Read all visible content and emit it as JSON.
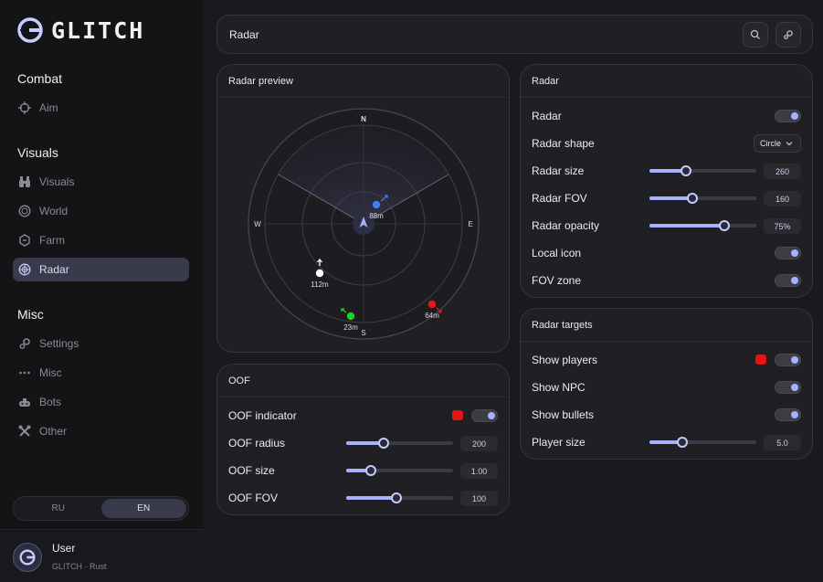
{
  "app": {
    "logo_text": "GLITCH"
  },
  "sidebar": {
    "sections": {
      "combat": "Combat",
      "visuals": "Visuals",
      "misc": "Misc"
    },
    "items": {
      "aim": "Aim",
      "visuals": "Visuals",
      "world": "World",
      "farm": "Farm",
      "radar": "Radar",
      "settings": "Settings",
      "misc": "Misc",
      "bots": "Bots",
      "other": "Other"
    },
    "active_item": "Radar",
    "language": {
      "options": [
        "RU",
        "EN"
      ],
      "selected": "EN"
    },
    "user": {
      "name": "User",
      "subtitle": "GLITCH · Rust"
    }
  },
  "header": {
    "title": "Radar"
  },
  "radar_preview": {
    "title": "Radar preview",
    "compass": {
      "north": "N",
      "east": "E",
      "south": "S",
      "west": "W"
    },
    "targets": [
      {
        "label": "88m",
        "color": "#3d7ef0"
      },
      {
        "label": "112m",
        "color": "#ffffff"
      },
      {
        "label": "23m",
        "color": "#1fd11f"
      },
      {
        "label": "64m",
        "color": "#e51616"
      }
    ]
  },
  "oof": {
    "title": "OOF",
    "indicator": {
      "label": "OOF indicator",
      "color": "#e21414",
      "enabled": true
    },
    "radius": {
      "label": "OOF radius",
      "value": "200",
      "fraction": 0.35
    },
    "size": {
      "label": "OOF size",
      "value": "1.00",
      "fraction": 0.23
    },
    "fov": {
      "label": "OOF FOV",
      "value": "100",
      "fraction": 0.47
    }
  },
  "radar_settings": {
    "title": "Radar",
    "radar": {
      "label": "Radar",
      "enabled": true
    },
    "shape": {
      "label": "Radar shape",
      "value": "Circle"
    },
    "size": {
      "label": "Radar size",
      "value": "260",
      "fraction": 0.34
    },
    "fov": {
      "label": "Radar FOV",
      "value": "160",
      "fraction": 0.4
    },
    "opacity": {
      "label": "Radar opacity",
      "value": "75%",
      "fraction": 0.7
    },
    "local_icon": {
      "label": "Local icon",
      "enabled": true
    },
    "fov_zone": {
      "label": "FOV zone",
      "enabled": true
    }
  },
  "radar_targets": {
    "title": "Radar targets",
    "players": {
      "label": "Show players",
      "color": "#e21414",
      "enabled": true
    },
    "npc": {
      "label": "Show NPC",
      "enabled": true
    },
    "bullets": {
      "label": "Show bullets",
      "enabled": true
    },
    "player_size": {
      "label": "Player size",
      "value": "5.0",
      "fraction": 0.31
    }
  },
  "colors": {
    "accent": "#a6b1ff",
    "active_nav": "#3a3a4d",
    "background": "#1a1a1e"
  },
  "icons": {
    "header_buttons": [
      "search-icon",
      "settings-icon"
    ],
    "nav": [
      "crosshair-icon",
      "binoculars-icon",
      "globe-icon",
      "leaf-icon",
      "radar-icon",
      "gears-icon",
      "dots-icon",
      "bots-icon",
      "tools-icon"
    ]
  }
}
